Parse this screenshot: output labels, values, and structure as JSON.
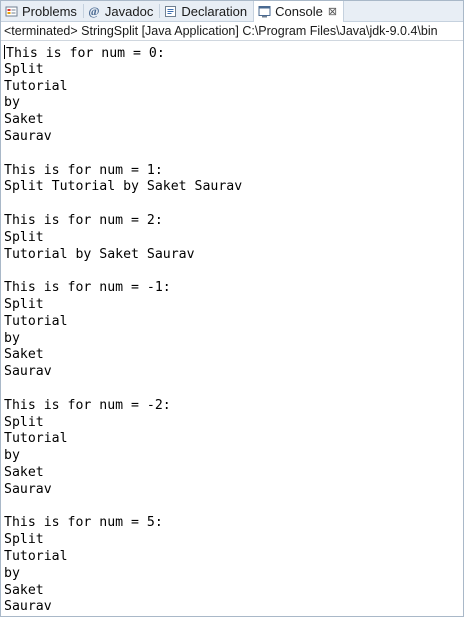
{
  "tabs": [
    {
      "label": "Problems",
      "icon": "problems-icon",
      "active": false
    },
    {
      "label": "Javadoc",
      "icon": "javadoc-icon",
      "active": false
    },
    {
      "label": "Declaration",
      "icon": "declaration-icon",
      "active": false
    },
    {
      "label": "Console",
      "icon": "console-icon",
      "active": true,
      "close": "⊠"
    }
  ],
  "status": "<terminated> StringSplit [Java Application] C:\\Program Files\\Java\\jdk-9.0.4\\bin",
  "console": {
    "lines": [
      "This is for num = 0:",
      "Split",
      "Tutorial",
      "by",
      "Saket",
      "Saurav",
      "",
      "This is for num = 1:",
      "Split Tutorial by Saket Saurav",
      "",
      "This is for num = 2:",
      "Split",
      "Tutorial by Saket Saurav",
      "",
      "This is for num = -1:",
      "Split",
      "Tutorial",
      "by",
      "Saket",
      "Saurav",
      "",
      "This is for num = -2:",
      "Split",
      "Tutorial",
      "by",
      "Saket",
      "Saurav",
      "",
      "This is for num = 5:",
      "Split",
      "Tutorial",
      "by",
      "Saket",
      "Saurav"
    ]
  }
}
